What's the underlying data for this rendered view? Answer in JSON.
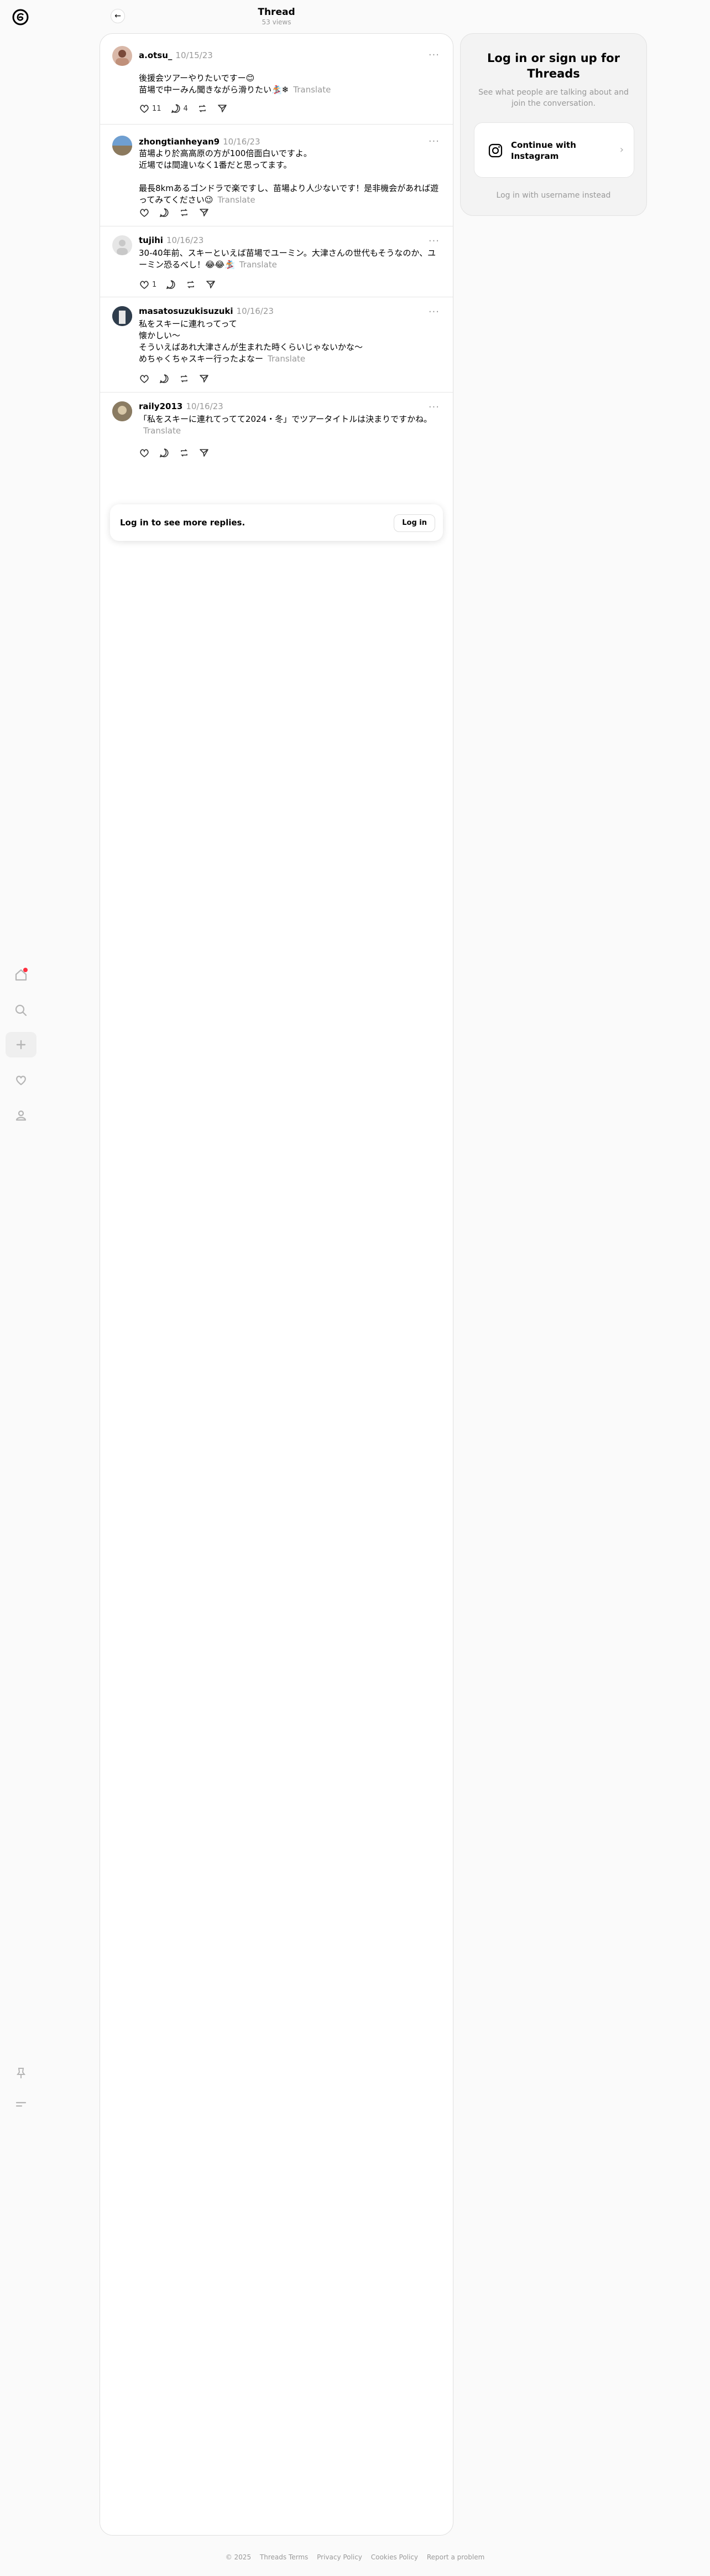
{
  "header": {
    "title": "Thread",
    "views": "53 views"
  },
  "posts": [
    {
      "username": "a.otsu_",
      "date": "10/15/23",
      "text": "後援会ツアーやりたいですー😊\n苗場で中ーみん聞きながら滑りたい🏂❄",
      "translate": "Translate",
      "likes": "11",
      "replies": "4"
    },
    {
      "username": "zhongtianheyan9",
      "date": "10/16/23",
      "text": "苗場より於高高原の方が100倍面白いですよ。\n近場では間違いなく1番だと思ってます。\n\n最長8kmあるゴンドラで楽ですし、苗場より人少ないです！是非機会があれば遊ってみてください😉",
      "translate": "Translate"
    },
    {
      "username": "tujihi",
      "date": "10/16/23",
      "text": "30-40年前、スキーといえば苗場でユーミン。大津さんの世代もそうなのか、ユーミン恐るべし！😂😂🏂",
      "translate": "Translate",
      "likes": "1"
    },
    {
      "username": "masatosuzukisuzuki",
      "date": "10/16/23",
      "text": "私をスキーに連れってって\n懐かしい〜\nそういえばあれ大津さんが生まれた時くらいじゃないかな〜\nめちゃくちゃスキー行ったよなー",
      "translate": "Translate"
    },
    {
      "username": "raily2013",
      "date": "10/16/23",
      "text": "「私をスキーに連れてってて2024・冬」でツアータイトルは決まりですかね。",
      "translate": "Translate"
    }
  ],
  "gate": {
    "text": "Log in to see more replies.",
    "button": "Log in"
  },
  "login_card": {
    "title": "Log in or sign up for Threads",
    "subtitle": "See what people are talking about and join the conversation.",
    "instagram_button": "Continue with Instagram",
    "username_link": "Log in with username instead"
  },
  "footer": {
    "copyright": "© 2025",
    "terms": "Threads Terms",
    "privacy": "Privacy Policy",
    "cookies": "Cookies Policy",
    "report": "Report a problem"
  },
  "colors": {
    "accent": "#000000",
    "muted": "#999999",
    "notification": "#ff3040"
  }
}
